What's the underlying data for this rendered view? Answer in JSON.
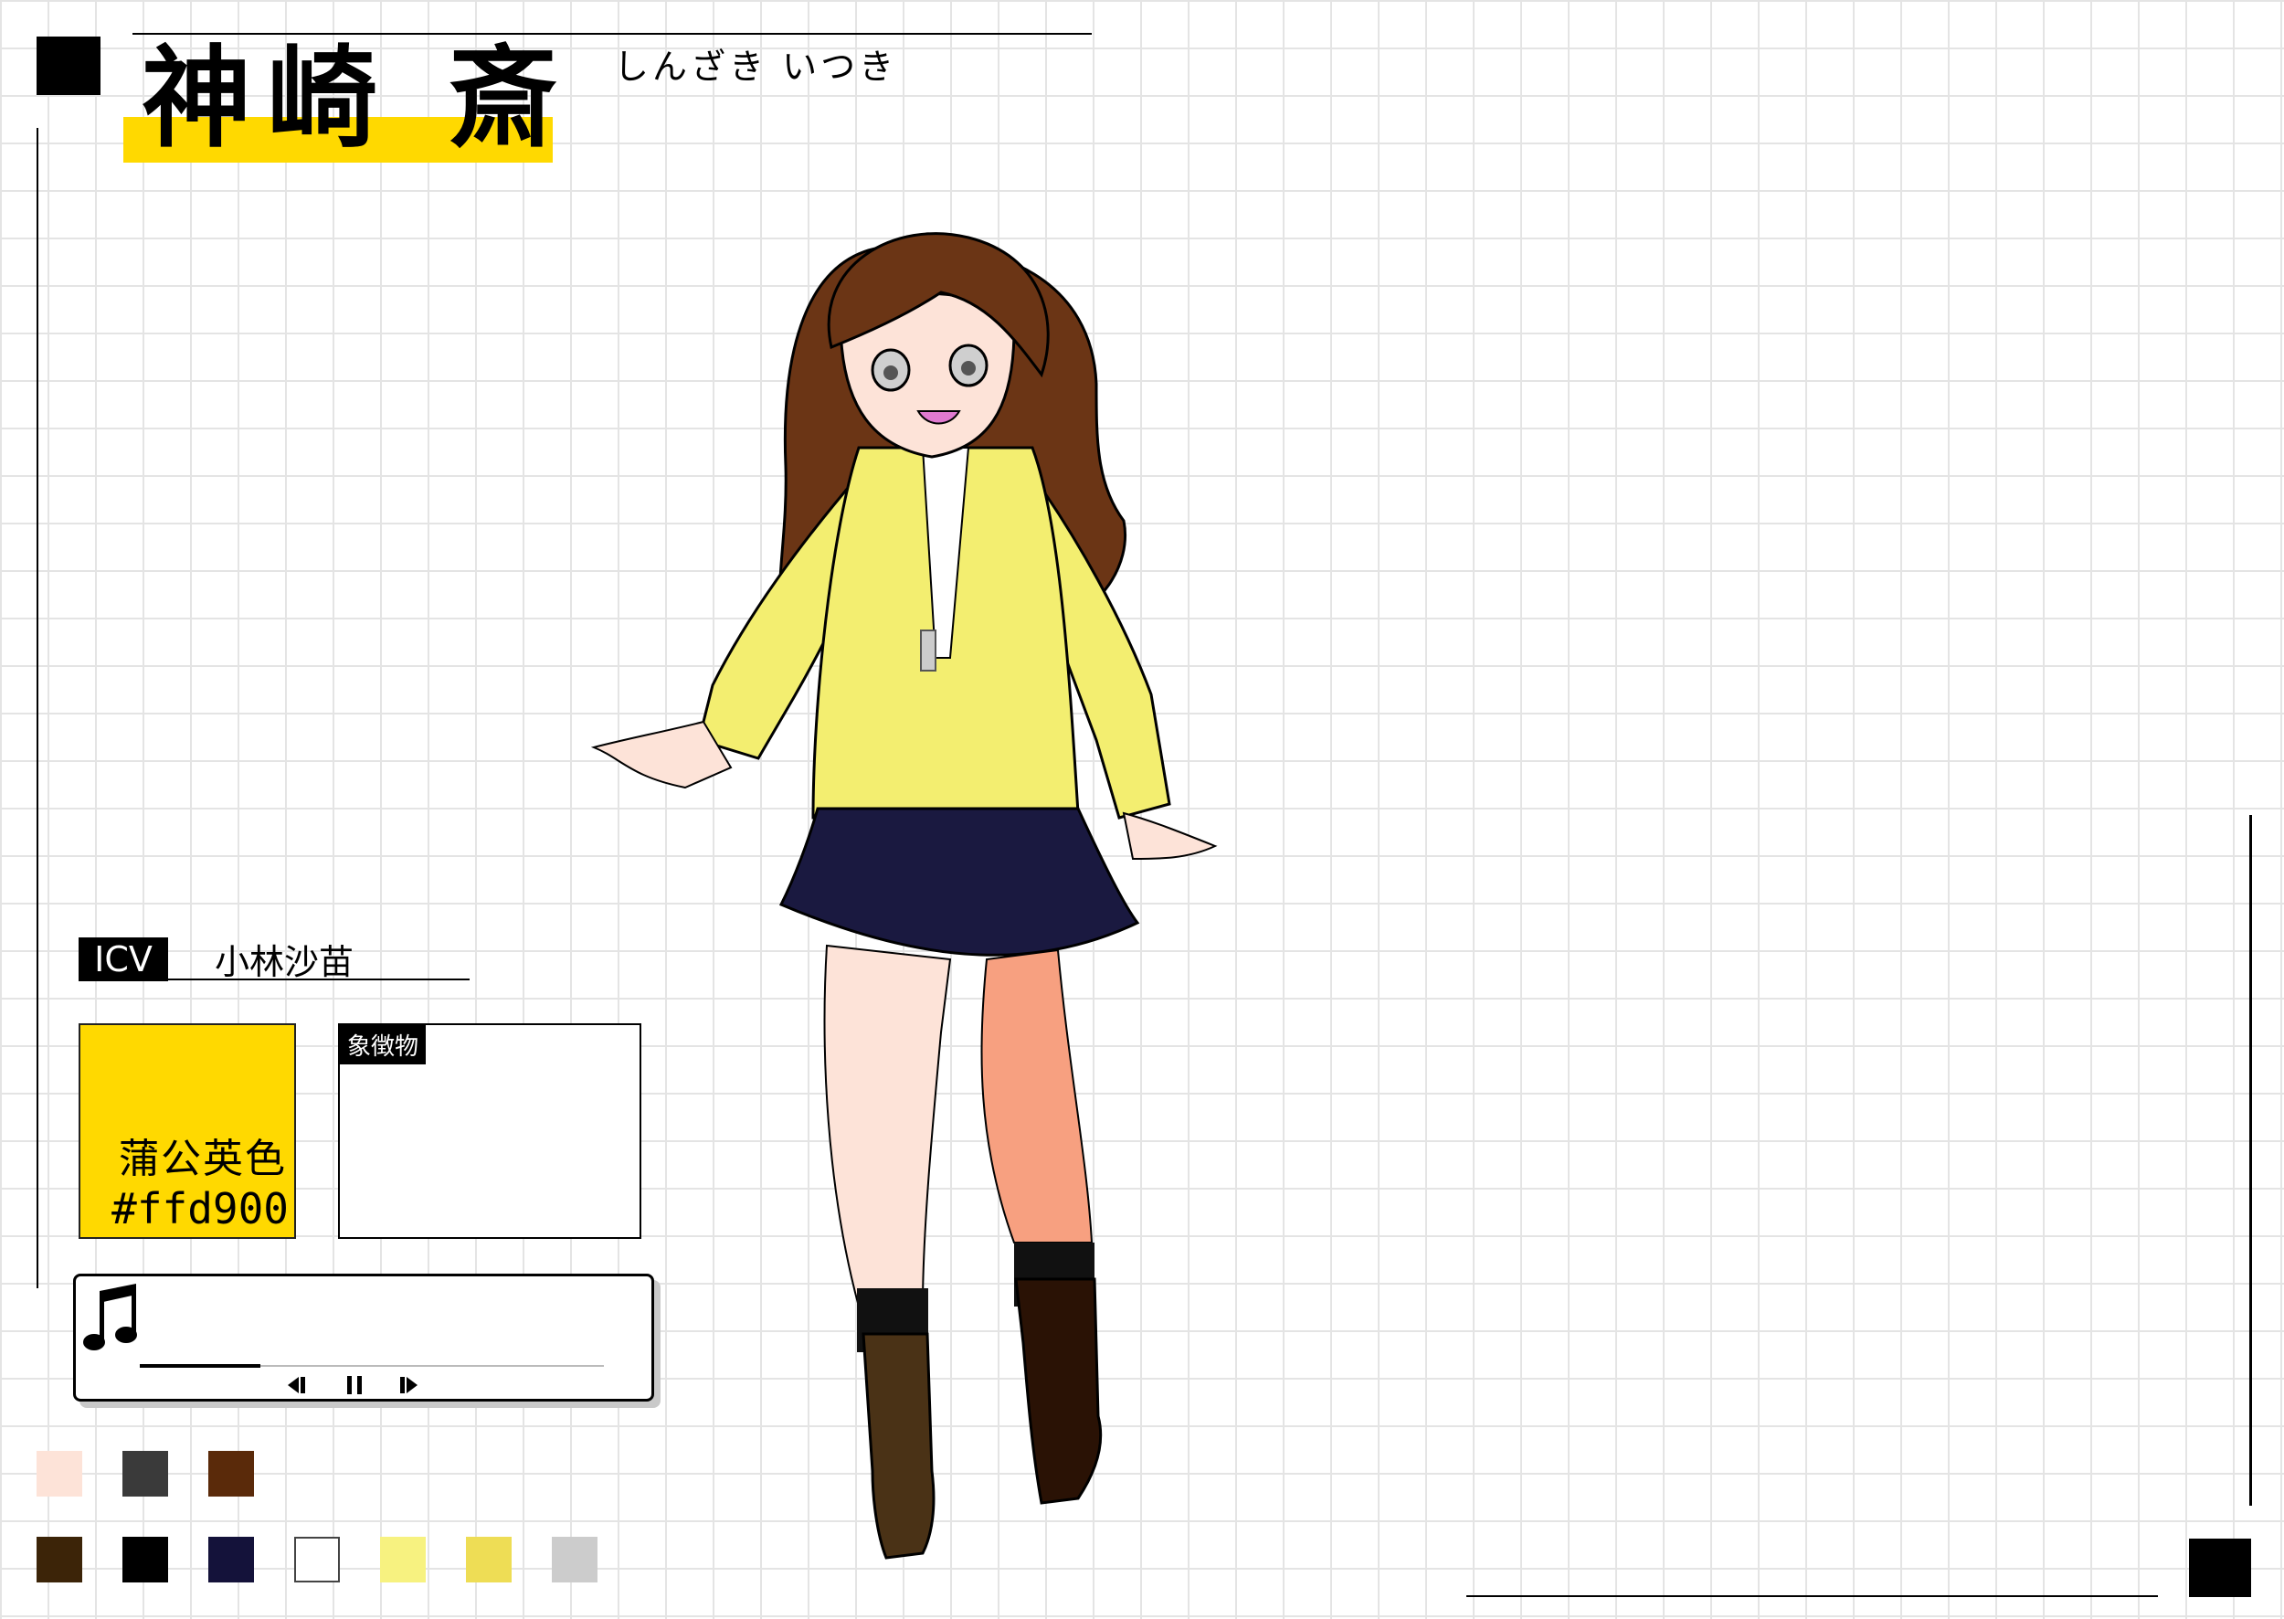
{
  "header": {
    "name": "神崎 斎",
    "reading": "しんざき いつき"
  },
  "cv": {
    "tag": "ICV",
    "name": "小林沙苗"
  },
  "color_card": {
    "name": "蒲公英色",
    "hex": "#ffd900",
    "color": "#ffd900"
  },
  "symbol": {
    "label": "象徴物"
  },
  "player": {
    "progress": 0.26,
    "icons": [
      "music-note-icon",
      "previous-icon",
      "pause-icon",
      "next-icon"
    ]
  },
  "palette": {
    "row1": [
      "#fde3d8",
      "#3a3a3a",
      "#5a2a0a"
    ],
    "row2": [
      "#3c2408",
      "#000000",
      "#14123a",
      "#ffffff",
      "#f7f280",
      "#eedd55",
      "#cccccc"
    ]
  },
  "character_colors": {
    "hair": "#6b3515",
    "jacket": "#f3ee70",
    "skirt": "#1a1940",
    "skin": "#fde3d8",
    "socks": "#111111",
    "boots": "#4a3216"
  }
}
